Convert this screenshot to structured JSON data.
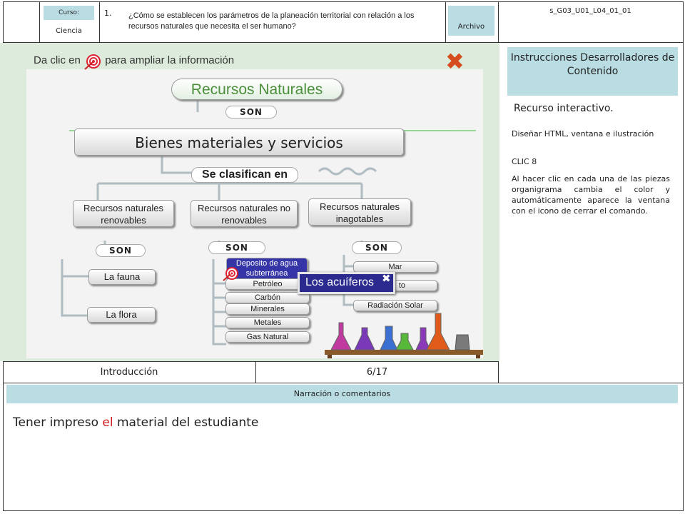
{
  "header": {
    "curso_label": "Curso:",
    "curso_value": "Ciencia",
    "question_number": "1.",
    "question_text": "¿Cómo se establecen los parámetros de la planeación territorial con relación a los recursos naturales que necesita el ser humano?",
    "archivo_label": "Archivo",
    "file_code": "s_G03_U01_L04_01_01"
  },
  "interactive": {
    "hint_before": "Da clic en",
    "hint_after": "para ampliar la información",
    "title": "Recursos Naturales",
    "son_label": "SON",
    "bienes": "Bienes materiales y servicios",
    "se_clasifican": "Se clasifican en",
    "categories": [
      "Recursos naturales renovables",
      "Recursos naturales no renovables",
      "Recursos naturales inagotables"
    ],
    "renovables": [
      "La fauna",
      "La flora"
    ],
    "no_renovables_highlight": "Deposito de agua subterránea",
    "no_renovables": [
      "Petróleo",
      "Carbón",
      "Minerales",
      "Metales",
      "Gas Natural"
    ],
    "inagotables": [
      "Mar",
      "to",
      "Radiación Solar"
    ],
    "popup_label": "Los acuíferos"
  },
  "right_panel": {
    "title": "Instrucciones Desarrolladores de Contenido",
    "subtitle": "Recurso interactivo.",
    "lines": [
      "Diseñar HTML, ventana e ilustración",
      "CLIC 8",
      "Al hacer clic en cada una de las piezas organigrama cambia el color y automáticamente aparece la ventana con el icono de cerrar el comando."
    ]
  },
  "footer": {
    "section": "Introducción",
    "page": "6/17",
    "narration_label": "Narración o comentarios",
    "note_before": "Tener impreso",
    "note_red": "el",
    "note_after": "material del estudiante"
  },
  "colors": {
    "header_tag": "#b9dde3",
    "title_green": "#4a8f3a",
    "close_red": "#d64d1e",
    "popup_blue": "#2b2b8f"
  }
}
